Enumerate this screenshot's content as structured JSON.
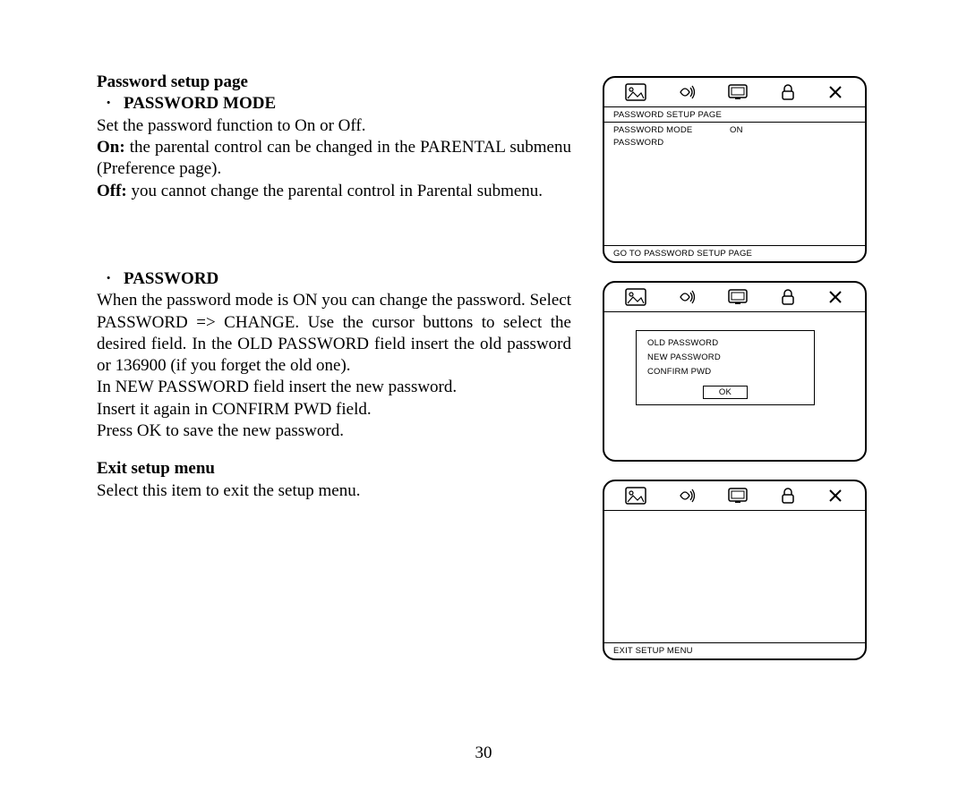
{
  "left": {
    "h1": "Password setup page",
    "b1_bullet": "·",
    "b1_label": "PASSWORD MODE",
    "p1": "Set the password function to On or Off.",
    "p2a": "On:",
    "p2b": " the parental control can be changed in the PARENTAL submenu (Preference page).",
    "p3a": "Off:",
    "p3b": " you cannot change the parental control in Parental submenu.",
    "b2_bullet": "·",
    "b2_label": "PASSWORD",
    "p4": "When the password mode is ON you can change the password. Select PASSWORD => CHANGE. Use the cursor buttons to select the desired field. In the OLD PASSWORD field insert the old password or 136900 (if you forget the old one).",
    "p5": "In NEW PASSWORD field insert the new password.",
    "p6": "Insert it again in CONFIRM PWD field.",
    "p7": "Press OK to save the new password.",
    "h2": "Exit setup menu",
    "p8": "Select this item to exit the setup menu."
  },
  "diagrams": {
    "d1": {
      "title": "PASSWORD SETUP PAGE",
      "row1_label": "PASSWORD MODE",
      "row1_value": "ON",
      "row2_label": "PASSWORD",
      "footer": "GO TO PASSWORD SETUP PAGE"
    },
    "d2": {
      "old": "OLD PASSWORD",
      "new": "NEW PASSWORD",
      "confirm": "CONFIRM PWD",
      "ok": "OK"
    },
    "d3": {
      "footer": "EXIT SETUP MENU"
    }
  },
  "page_num": "30"
}
